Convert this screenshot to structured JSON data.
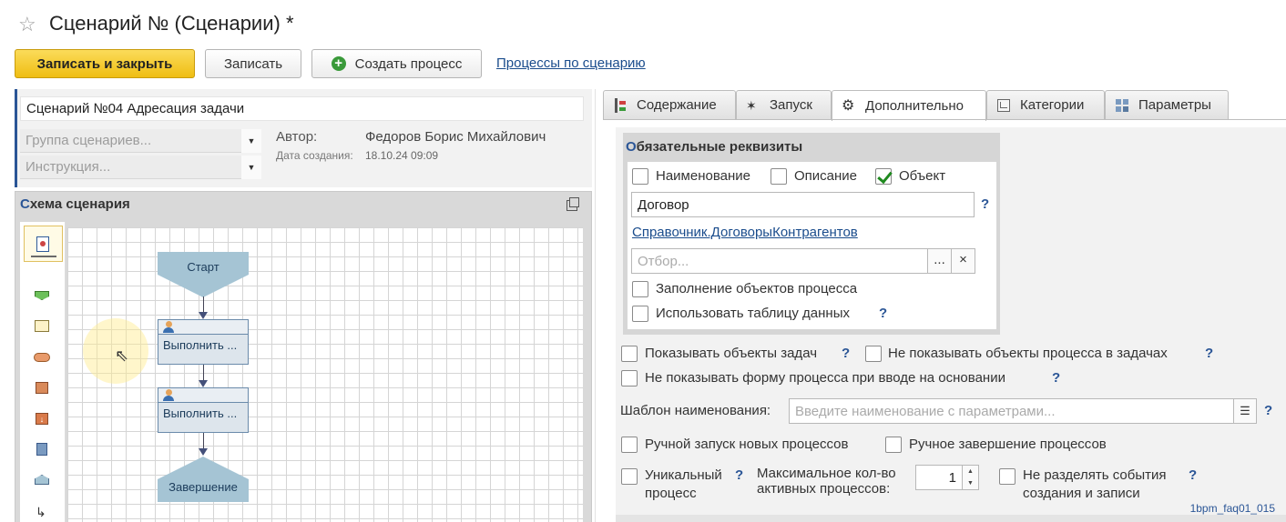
{
  "window": {
    "title": "Сценарий № (Сценарии) *",
    "favorite_icon": "star-icon"
  },
  "toolbar": {
    "save_close_label": "Записать и закрыть",
    "save_label": "Записать",
    "create_process_label": "Создать процесс",
    "processes_link": "Процессы по сценарию"
  },
  "header": {
    "name_value": "Сценарий №04 Адресация задачи",
    "group_placeholder": "Группа сценариев...",
    "instruction_placeholder": "Инструкция...",
    "author_label": "Автор:",
    "author_value": "Федоров Борис Михайлович",
    "date_label": "Дата создания:",
    "date_value": "18.10.24 09:09"
  },
  "schema": {
    "title_first": "С",
    "title_rest": "хема сценария",
    "palette_icons": [
      "start-shape-icon",
      "task-shape-icon",
      "decision-shape-icon",
      "subprocess-shape-icon",
      "input-shape-icon",
      "process-shape-icon",
      "end-shape-icon",
      "connector-icon"
    ],
    "nodes": {
      "start": "Старт",
      "task1": "Выполнить ...",
      "task2": "Выполнить ...",
      "end": "Завершение"
    }
  },
  "tabs": [
    {
      "label": "Содержание",
      "icon": "content-icon"
    },
    {
      "label": "Запуск",
      "icon": "wand-icon"
    },
    {
      "label": "Дополнительно",
      "icon": "gear-icon",
      "active": true
    },
    {
      "label": "Категории",
      "icon": "category-icon"
    },
    {
      "label": "Параметры",
      "icon": "parameters-icon"
    }
  ],
  "required": {
    "title_first": "О",
    "title_rest": "бязательные реквизиты",
    "name_label": "Наименование",
    "name_checked": false,
    "description_label": "Описание",
    "description_checked": false,
    "object_label": "Объект",
    "object_checked": true,
    "object_value": "Договор",
    "catalog_link": "Справочник.ДоговорыКонтрагентов",
    "filter_placeholder": "Отбор...",
    "filter_select_label": "...",
    "filter_clear_label": "×",
    "fill_objects_label": "Заполнение объектов процесса",
    "use_table_label": "Использовать таблицу данных"
  },
  "options": {
    "show_task_objects": "Показывать объекты задач",
    "hide_process_objects": "Не показывать объекты процесса в задачах",
    "hide_form_on_input": "Не показывать форму процесса при вводе на основании",
    "name_template_label": "Шаблон наименования:",
    "name_template_placeholder": "Введите наименование с параметрами...",
    "manual_start": "Ручной запуск новых процессов",
    "manual_finish": "Ручное завершение процессов",
    "unique_line1": "Уникальный",
    "unique_line2": "процесс",
    "max_active_line1": "Максимальное кол-во",
    "max_active_line2": "активных процессов:",
    "max_active_value": "1",
    "no_split_line1": "Не разделять события",
    "no_split_line2": "создания и записи"
  },
  "help_mark": "?",
  "footer_id": "1bpm_faq01_015"
}
